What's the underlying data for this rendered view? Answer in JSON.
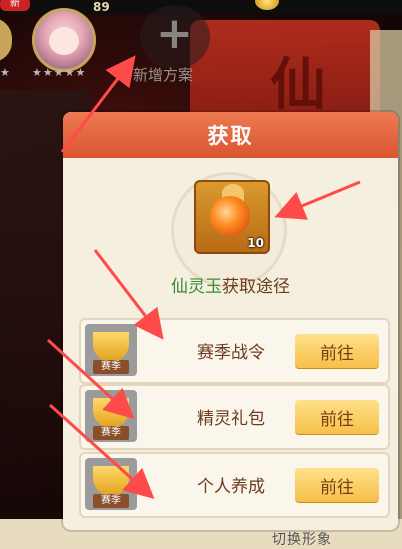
{
  "top_bar": {
    "level": "89",
    "badge": "新"
  },
  "add_plan": {
    "label": "新增方案"
  },
  "banner_char": "仙",
  "stars": "★★★★★",
  "modal": {
    "title": "获取",
    "item_count": "10",
    "source_title": {
      "item": "仙灵玉",
      "rest": "获取途径"
    },
    "routes": [
      {
        "label": "赛季战令",
        "tag": "赛季",
        "button": "前往"
      },
      {
        "label": "精灵礼包",
        "tag": "赛季",
        "button": "前往"
      },
      {
        "label": "个人养成",
        "tag": "赛季",
        "button": "前往"
      }
    ]
  },
  "bottom_label": "切换形象",
  "colors": {
    "header": "#e56a40",
    "button": "#f6c04a",
    "arrow": "#ff3b3b"
  }
}
